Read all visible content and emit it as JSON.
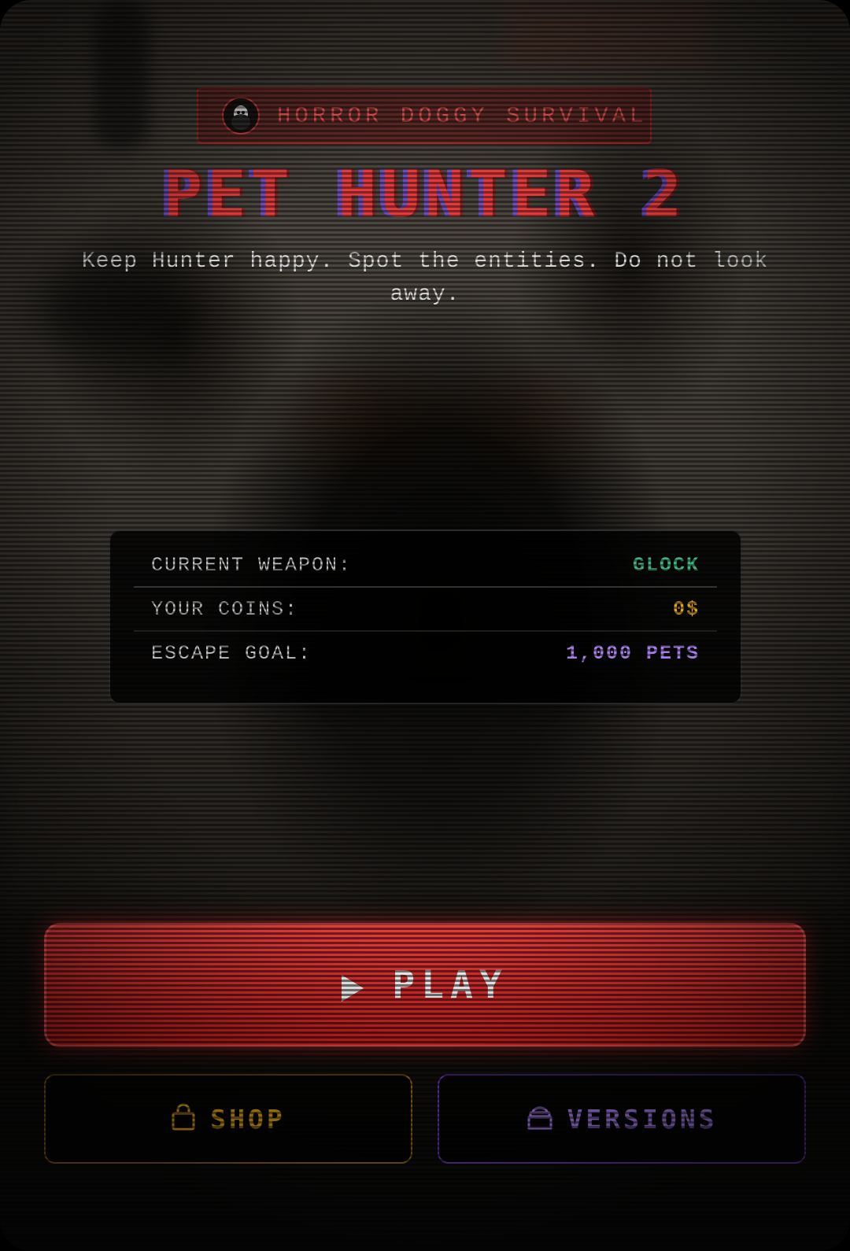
{
  "tag": {
    "text": "HORROR DOGGY SURVIVAL"
  },
  "title": "PET HUNTER 2",
  "subtitle": "Keep Hunter happy. Spot the entities. Do not look away.",
  "stats": [
    {
      "label": "CURRENT WEAPON:",
      "value": "GLOCK",
      "color": "#3fb27f"
    },
    {
      "label": "YOUR COINS:",
      "value": "0$",
      "color": "#e2a51c"
    },
    {
      "label": "ESCAPE GOAL:",
      "value": "1,000 PETS",
      "color": "#a57ee8"
    }
  ],
  "buttons": {
    "play": {
      "label": "PLAY",
      "icon": "play-icon"
    },
    "shop": {
      "label": "SHOP",
      "icon": "shopping-bag-icon"
    },
    "versions": {
      "label": "VERSIONS",
      "icon": "pet-food-bowl-icon"
    }
  },
  "colors": {
    "accent_red": "#e23a3a",
    "gold": "#e2a51c",
    "purple": "#a57ee8",
    "green": "#3fb27f"
  }
}
